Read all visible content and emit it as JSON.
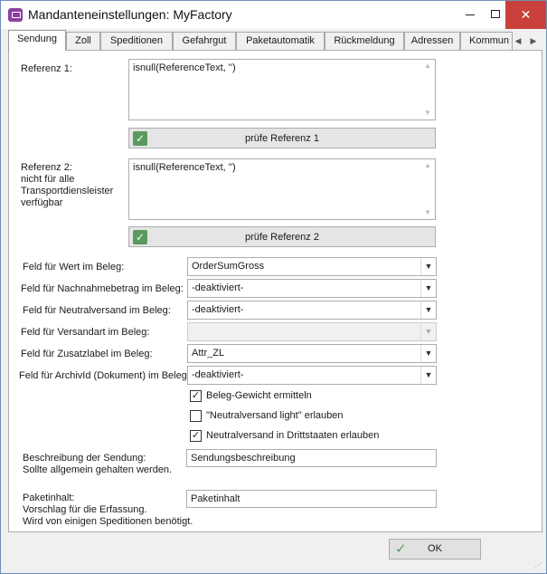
{
  "window": {
    "title": "Mandanteneinstellungen: MyFactory"
  },
  "tabs": [
    {
      "label": "Sendung"
    },
    {
      "label": "Zoll"
    },
    {
      "label": "Speditionen"
    },
    {
      "label": "Gefahrgut"
    },
    {
      "label": "Paketautomatik"
    },
    {
      "label": "Rückmeldung"
    },
    {
      "label": "Adressen"
    },
    {
      "label": "Kommun"
    }
  ],
  "referenz1": {
    "label": "Referenz 1:",
    "value": "isnull(ReferenceText, '')",
    "check_button": "prüfe Referenz 1"
  },
  "referenz2": {
    "label_line1": "Referenz 2:",
    "label_line2": "nicht für alle",
    "label_line3": "Transportdiensleister",
    "label_line4": "verfügbar",
    "value": "isnull(ReferenceText, '')",
    "check_button": "prüfe Referenz 2"
  },
  "fields": [
    {
      "label": "Feld für Wert im Beleg:",
      "value": "OrderSumGross",
      "enabled": true
    },
    {
      "label": "Feld für Nachnahmebetrag im Beleg:",
      "value": "-deaktiviert-",
      "enabled": true
    },
    {
      "label": "Feld für Neutralversand im Beleg:",
      "value": "-deaktiviert-",
      "enabled": true
    },
    {
      "label": "Feld für Versandart im Beleg:",
      "value": "",
      "enabled": false
    },
    {
      "label": "Feld für Zusatzlabel im Beleg:",
      "value": "Attr_ZL",
      "enabled": true
    },
    {
      "label": "Feld für ArchivId (Dokument) im Beleg:",
      "value": "-deaktiviert-",
      "enabled": true
    }
  ],
  "checkboxes": [
    {
      "label": "Beleg-Gewicht ermitteln",
      "checked": true
    },
    {
      "label": "\"Neutralversand light\" erlauben",
      "checked": false
    },
    {
      "label": "Neutralversand in Drittstaaten erlauben",
      "checked": true
    }
  ],
  "beschreibung": {
    "label_line1": "Beschreibung der Sendung:",
    "label_line2": "Sollte allgemein gehalten werden.",
    "value": "Sendungsbeschreibung"
  },
  "paketinhalt": {
    "label_line1": "Paketinhalt:",
    "label_line2": "Vorschlag für die Erfassung.",
    "label_line3": "Wird von einigen Speditionen benötigt.",
    "value": "Paketinhalt"
  },
  "footer": {
    "ok_label": "OK"
  },
  "icons": {
    "check": "✓",
    "checkbox_checked": "✓"
  },
  "colors": {
    "close_button": "#c9413a",
    "check_icon": "#5a9a5e",
    "app_icon": "#8e3fa3"
  }
}
